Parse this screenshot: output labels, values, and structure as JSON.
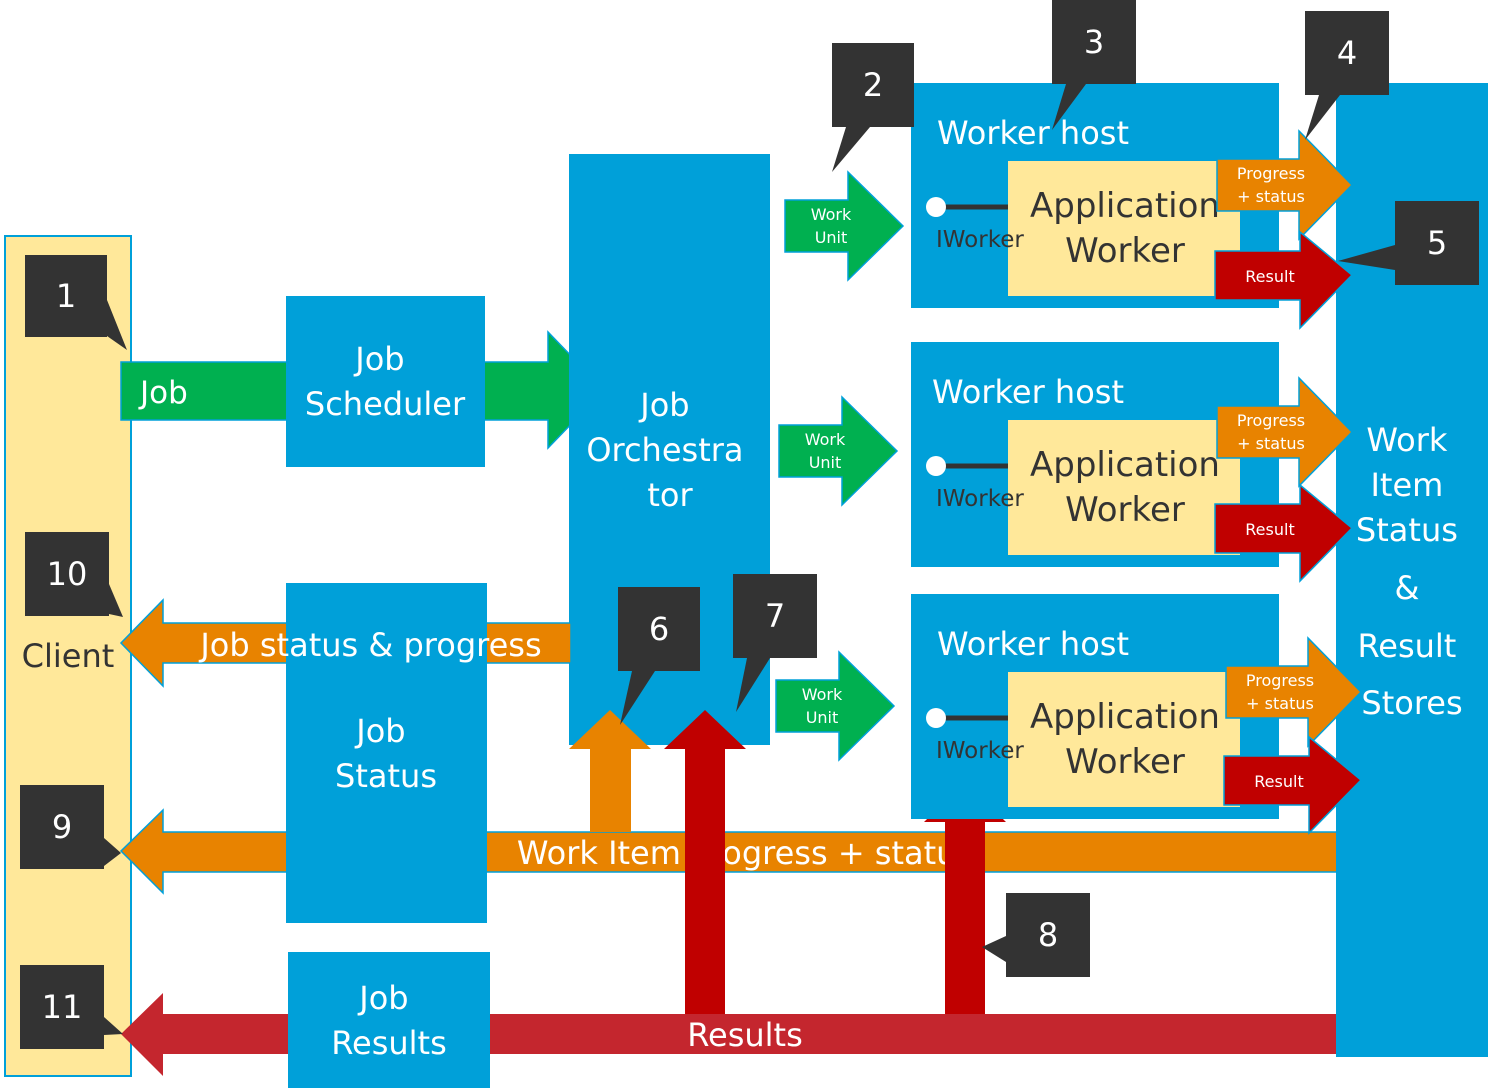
{
  "colors": {
    "blue": "#00a0d9",
    "green": "#00b050",
    "orange": "#e88300",
    "red": "#c00000",
    "red_bar": "#c4262e",
    "yellow": "#ffe89a",
    "callout": "#333333",
    "white": "#ffffff"
  },
  "client": {
    "label": "Client"
  },
  "job_arrow": {
    "label": "Job"
  },
  "job_scheduler": {
    "lines": [
      "Job",
      "Scheduler"
    ]
  },
  "job_orchestrator": {
    "lines": [
      "Job",
      "Orchestra",
      "tor"
    ]
  },
  "job_status": {
    "lines": [
      "Job",
      "Status"
    ]
  },
  "job_results": {
    "lines": [
      "Job",
      "Results"
    ]
  },
  "stores": {
    "lines": [
      "Work",
      "Item",
      "Status",
      "&",
      "Result",
      "Stores"
    ]
  },
  "worker_hosts": [
    {
      "title": "Worker host",
      "app_lines": [
        "Application",
        "Worker"
      ],
      "interface": "IWorker",
      "work_unit": [
        "Work",
        "Unit"
      ],
      "progress": [
        "Progress",
        "+ status"
      ],
      "result": "Result"
    },
    {
      "title": "Worker host",
      "app_lines": [
        "Application",
        "Worker"
      ],
      "interface": "IWorker",
      "work_unit": [
        "Work",
        "Unit"
      ],
      "progress": [
        "Progress",
        "+ status"
      ],
      "result": "Result"
    },
    {
      "title": "Worker host",
      "app_lines": [
        "Application",
        "Worker"
      ],
      "interface": "IWorker",
      "work_unit": [
        "Work",
        "Unit"
      ],
      "progress": [
        "Progress",
        "+ status"
      ],
      "result": "Result"
    }
  ],
  "flows": {
    "job_status_progress": "Job status & progress",
    "work_item_progress": "Work Item Progress + status",
    "results": "Results"
  },
  "callouts": [
    "1",
    "2",
    "3",
    "4",
    "5",
    "6",
    "7",
    "8",
    "9",
    "10",
    "11"
  ]
}
